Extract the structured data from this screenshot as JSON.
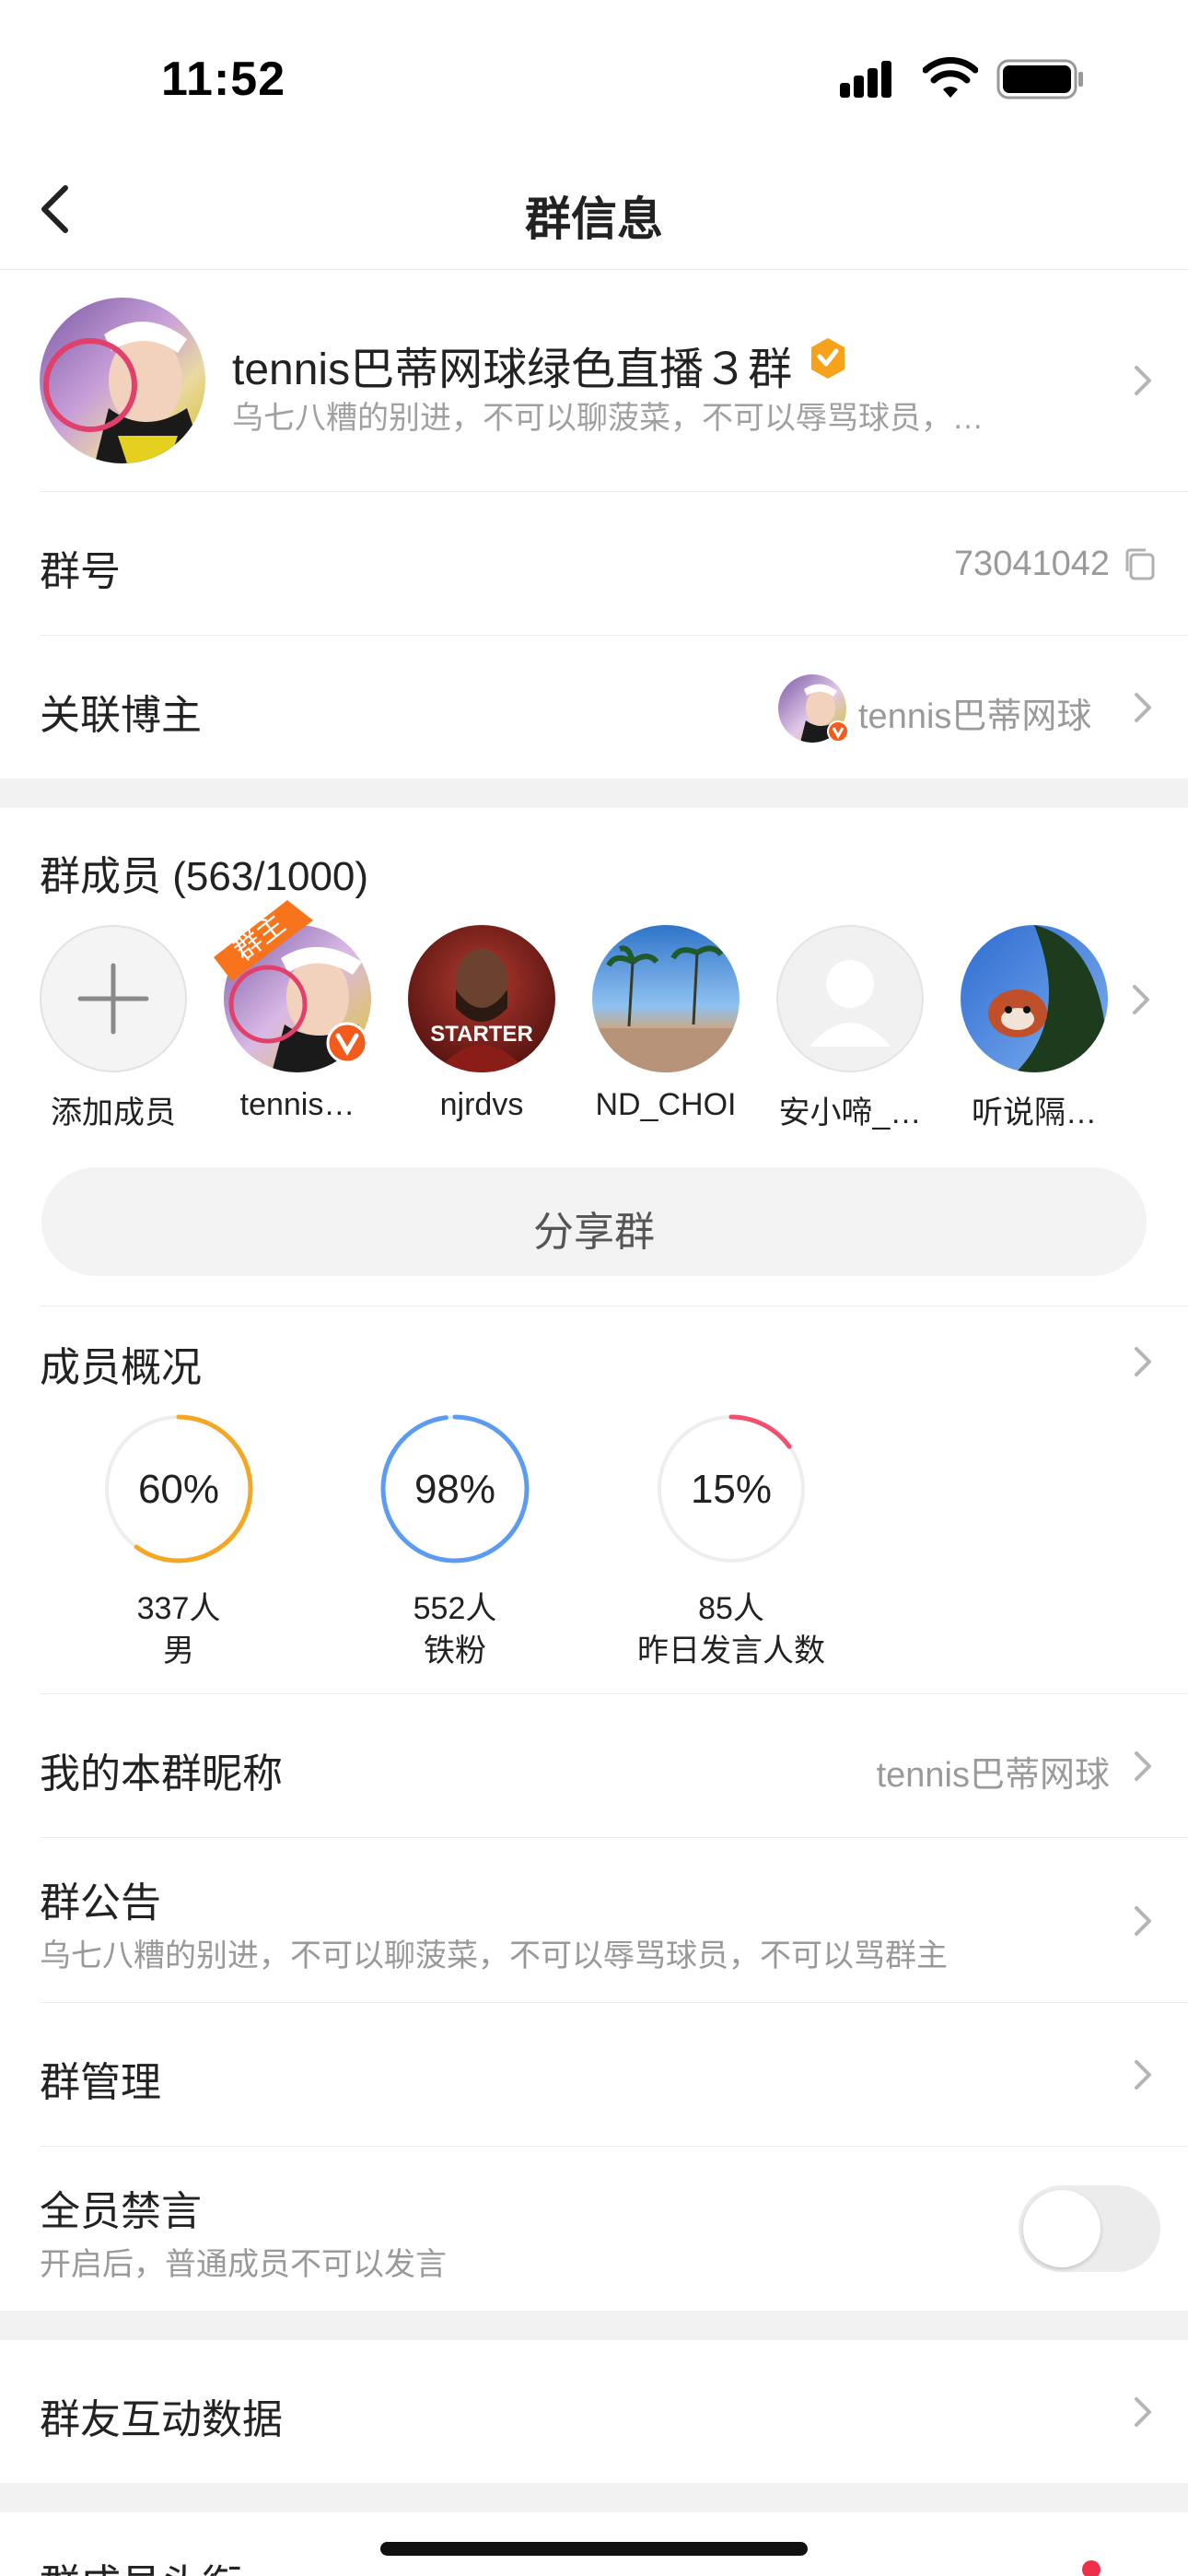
{
  "status": {
    "time": "11:52"
  },
  "nav": {
    "title": "群信息"
  },
  "group": {
    "name": "tennis巴蒂网球绿色直播３群",
    "description": "乌七八糟的别进，不可以聊菠菜，不可以辱骂球员，…"
  },
  "group_id": {
    "label": "群号",
    "value": "73041042"
  },
  "linked_blogger": {
    "label": "关联博主",
    "value": "tennis巴蒂网球"
  },
  "members": {
    "title": "群成员 (563/1000)",
    "list": [
      {
        "name": "添加成员"
      },
      {
        "name": "tennis…",
        "badge": "群主"
      },
      {
        "name": "njrdvs",
        "avatar_text": "STARTER"
      },
      {
        "name": "ND_CHOI"
      },
      {
        "name": "安小啼_…"
      },
      {
        "name": "听说隔…"
      }
    ]
  },
  "share": {
    "label": "分享群"
  },
  "overview": {
    "title": "成员概况",
    "stats": [
      {
        "percent": "60%",
        "count": "337人",
        "label": "男",
        "fraction": 0.6,
        "color": "#f5a623"
      },
      {
        "percent": "98%",
        "count": "552人",
        "label": "铁粉",
        "fraction": 0.98,
        "color": "#5b9cf2"
      },
      {
        "percent": "15%",
        "count": "85人",
        "label": "昨日发言人数",
        "fraction": 0.15,
        "color": "#f0506e"
      }
    ]
  },
  "nickname": {
    "label": "我的本群昵称",
    "value": "tennis巴蒂网球"
  },
  "notice": {
    "label": "群公告",
    "text": "乌七八糟的别进，不可以聊菠菜，不可以辱骂球员，不可以骂群主"
  },
  "management": {
    "label": "群管理"
  },
  "mute_all": {
    "label": "全员禁言",
    "hint": "开启后，普通成员不可以发言",
    "enabled": false
  },
  "interaction": {
    "label": "群友互动数据"
  },
  "member_title": {
    "label": "群成员头衔"
  }
}
